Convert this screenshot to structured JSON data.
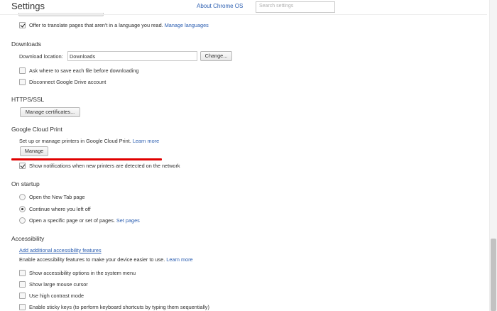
{
  "header": {
    "title": "Settings",
    "about_link": "About Chrome OS",
    "search_placeholder": "Search settings"
  },
  "languages": {
    "translate_label": "Offer to translate pages that aren't in a language you read.",
    "translate_checked": true,
    "manage_languages_link": "Manage languages"
  },
  "downloads": {
    "heading": "Downloads",
    "location_label": "Download location:",
    "location_value": "Downloads",
    "change_button": "Change...",
    "ask_label": "Ask where to save each file before downloading",
    "ask_checked": false,
    "drive_label": "Disconnect Google Drive account",
    "drive_checked": false
  },
  "https": {
    "heading": "HTTPS/SSL",
    "manage_certificates_button": "Manage certificates..."
  },
  "cloud_print": {
    "heading": "Google Cloud Print",
    "description": "Set up or manage printers in Google Cloud Print.",
    "learn_more_link": "Learn more",
    "manage_button": "Manage",
    "notify_label": "Show notifications when new printers are detected on the network",
    "notify_checked": true,
    "annotation_color": "#e00000"
  },
  "startup": {
    "heading": "On startup",
    "options": [
      {
        "label": "Open the New Tab page",
        "checked": false
      },
      {
        "label": "Continue where you left off",
        "checked": true
      },
      {
        "label": "Open a specific page or set of pages.",
        "checked": false
      }
    ],
    "set_pages_link": "Set pages"
  },
  "accessibility": {
    "heading": "Accessibility",
    "add_features_link": "Add additional accessibility features",
    "enable_text": "Enable accessibility features to make your device easier to use.",
    "learn_more_link": "Learn more",
    "options": [
      {
        "label": "Show accessibility options in the system menu",
        "checked": false
      },
      {
        "label": "Show large mouse cursor",
        "checked": false
      },
      {
        "label": "Use high contrast mode",
        "checked": false
      },
      {
        "label": "Enable sticky keys (to perform keyboard shortcuts by typing them sequentially)",
        "checked": false
      }
    ]
  },
  "colors": {
    "link": "#2a5db0",
    "text": "#303030",
    "annotation": "#e00000"
  }
}
